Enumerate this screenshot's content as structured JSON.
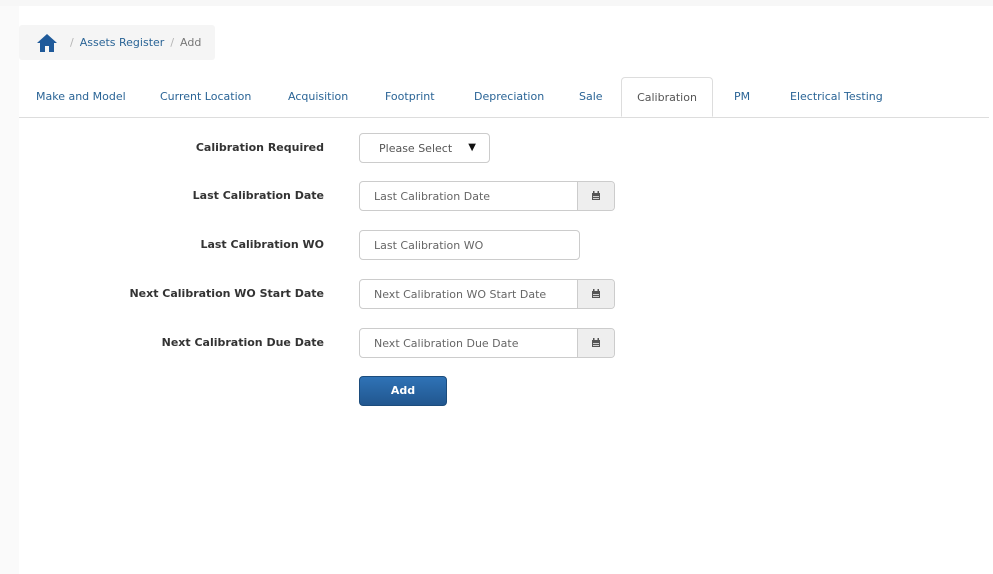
{
  "breadcrumb": {
    "home_icon": "home-icon",
    "items": [
      "Assets Register",
      "Add"
    ],
    "separator": "/"
  },
  "tabs": [
    {
      "label": "Make and Model"
    },
    {
      "label": "Current Location"
    },
    {
      "label": "Acquisition"
    },
    {
      "label": "Footprint"
    },
    {
      "label": "Depreciation"
    },
    {
      "label": "Sale"
    },
    {
      "label": "Calibration",
      "active": true
    },
    {
      "label": "PM"
    },
    {
      "label": "Electrical Testing"
    }
  ],
  "form": {
    "calibration_required": {
      "label": "Calibration Required",
      "value": "Please Select"
    },
    "last_calibration_date": {
      "label": "Last Calibration Date",
      "placeholder": "Last Calibration Date",
      "icon": "calendar-icon"
    },
    "last_calibration_wo": {
      "label": "Last Calibration WO",
      "placeholder": "Last Calibration WO"
    },
    "next_wo_start_date": {
      "label": "Next Calibration WO Start Date",
      "placeholder": "Next Calibration WO Start Date",
      "icon": "calendar-icon"
    },
    "next_due_date": {
      "label": "Next Calibration Due Date",
      "placeholder": "Next Calibration Due Date",
      "icon": "calendar-icon"
    },
    "add_label": "Add"
  },
  "colors": {
    "link": "#2a6496",
    "button": "#2a6bae",
    "home_icon": "#1f5a9a"
  }
}
